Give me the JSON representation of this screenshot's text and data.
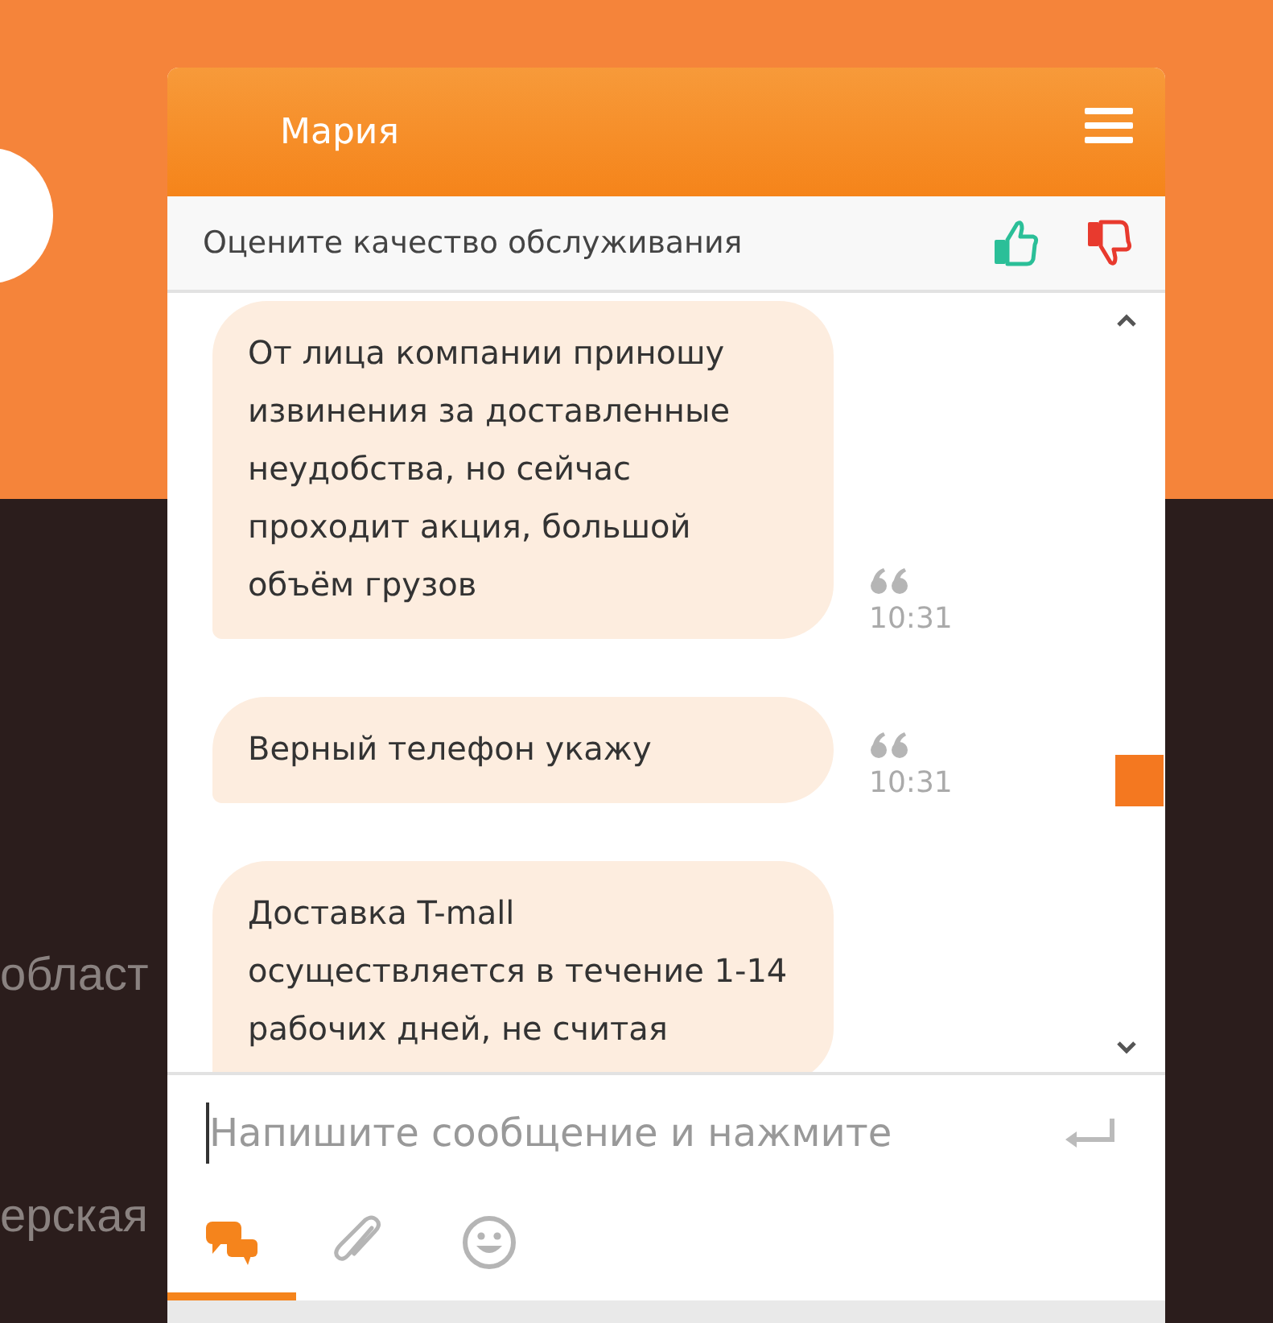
{
  "background": {
    "texts": [
      "област",
      "ерская"
    ]
  },
  "chat": {
    "agent_name": "Мария",
    "rating": {
      "prompt": "Оцените качество обслуживания"
    },
    "messages": [
      {
        "text": "От лица компании приношу извинения за доставленные неудобства, но сейчас проходит акция, большой объём грузов",
        "time": "10:31"
      },
      {
        "text": "Верный телефон укажу",
        "time": "10:31"
      },
      {
        "text": "Доставка T-mall осуществляется в течение 1-14 рабочих дней, не считая"
      }
    ],
    "input": {
      "placeholder": "Напишите сообщение и нажмите"
    },
    "tabs": [
      {
        "kind": "chat",
        "selected": true
      },
      {
        "kind": "attach",
        "selected": false
      },
      {
        "kind": "emoji",
        "selected": false
      }
    ]
  }
}
